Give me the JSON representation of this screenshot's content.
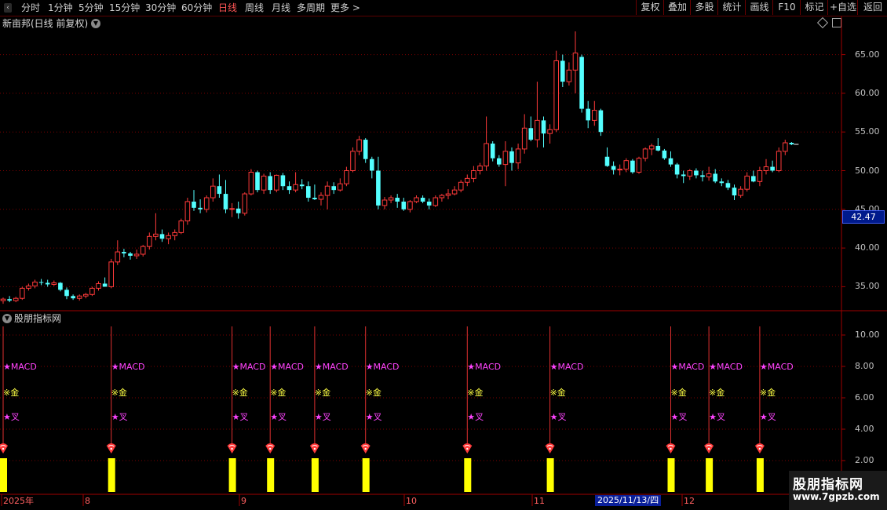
{
  "toolbar": {
    "periods": [
      {
        "label": "分时",
        "active": false
      },
      {
        "label": "1分钟",
        "active": false
      },
      {
        "label": "5分钟",
        "active": false
      },
      {
        "label": "15分钟",
        "active": false
      },
      {
        "label": "30分钟",
        "active": false
      },
      {
        "label": "60分钟",
        "active": false
      },
      {
        "label": "日线",
        "active": true
      },
      {
        "label": "周线",
        "active": false
      },
      {
        "label": "月线",
        "active": false
      },
      {
        "label": "多周期",
        "active": false
      },
      {
        "label": "更多 >",
        "active": false
      }
    ],
    "actions": [
      "复权",
      "叠加",
      "多股",
      "统计",
      "画线",
      "F10",
      "标记",
      "+自选",
      "返回"
    ]
  },
  "stock": {
    "title": "新亩邦(日线 前复权)"
  },
  "price_axis": {
    "labels": [
      "65.00",
      "60.00",
      "55.00",
      "50.00",
      "45.00",
      "40.00",
      "35.00"
    ],
    "current_price": "42.47"
  },
  "indicator": {
    "title": "股朋指标网",
    "axis_labels": [
      "10.00",
      "8.00",
      "6.00",
      "4.00",
      "2.00"
    ],
    "signal_texts": {
      "macd": "★MACD",
      "gold": "※金",
      "cross": "★叉"
    },
    "signals_count_note": ""
  },
  "dates": {
    "labels": [
      "2025年",
      "8",
      "9",
      "10",
      "11",
      "12"
    ],
    "cursor": "2025/11/13/四"
  },
  "watermark": {
    "line1": "股朋指标网",
    "line2": "www.7gpzb.com"
  },
  "colors": {
    "up": "#ff3a3a",
    "down": "#54ffff",
    "grid": "#7a0000",
    "signal_bar": "#ffff00",
    "signal_line": "#e03030"
  },
  "chart_data": {
    "type": "candlestick",
    "y_axis_labels": [
      "65.00",
      "60.00",
      "55.00",
      "50.00",
      "45.00",
      "40.00",
      "35.00"
    ],
    "ylim": [
      32,
      68
    ],
    "candles": [
      [
        33.2,
        33.6,
        32.8,
        33.4
      ],
      [
        33.4,
        33.8,
        33.0,
        33.2
      ],
      [
        33.2,
        33.7,
        33.0,
        33.5
      ],
      [
        33.5,
        35.0,
        33.3,
        34.8
      ],
      [
        34.8,
        35.4,
        34.5,
        35.1
      ],
      [
        35.1,
        35.9,
        34.8,
        35.6
      ],
      [
        35.6,
        36.0,
        35.2,
        35.5
      ],
      [
        35.5,
        35.9,
        35.0,
        35.3
      ],
      [
        35.3,
        35.8,
        35.1,
        35.5
      ],
      [
        35.5,
        35.6,
        34.4,
        34.6
      ],
      [
        34.6,
        34.9,
        33.4,
        33.8
      ],
      [
        33.8,
        34.0,
        33.3,
        33.5
      ],
      [
        33.5,
        34.0,
        33.2,
        33.8
      ],
      [
        33.8,
        34.2,
        33.5,
        34.0
      ],
      [
        34.0,
        35.0,
        33.8,
        34.8
      ],
      [
        34.8,
        35.7,
        34.5,
        35.4
      ],
      [
        35.4,
        36.2,
        35.0,
        35.0
      ],
      [
        35.0,
        38.6,
        34.8,
        38.2
      ],
      [
        38.2,
        41.0,
        37.8,
        39.5
      ],
      [
        39.5,
        39.9,
        38.8,
        39.3
      ],
      [
        39.3,
        39.5,
        38.5,
        39.0
      ],
      [
        39.0,
        39.8,
        38.6,
        39.2
      ],
      [
        39.2,
        40.4,
        38.9,
        40.2
      ],
      [
        40.2,
        42.0,
        39.8,
        41.5
      ],
      [
        41.5,
        44.5,
        41.0,
        41.8
      ],
      [
        41.8,
        42.4,
        40.8,
        41.2
      ],
      [
        41.2,
        42.0,
        40.5,
        41.6
      ],
      [
        41.6,
        42.4,
        41.0,
        42.0
      ],
      [
        42.0,
        43.8,
        41.8,
        43.5
      ],
      [
        43.5,
        46.5,
        43.0,
        46.0
      ],
      [
        46.0,
        47.5,
        44.8,
        45.2
      ],
      [
        45.2,
        46.3,
        44.5,
        45.0
      ],
      [
        45.0,
        46.8,
        44.6,
        46.5
      ],
      [
        46.5,
        49.0,
        46.0,
        48.0
      ],
      [
        48.0,
        49.5,
        46.5,
        47.0
      ],
      [
        47.0,
        48.8,
        44.5,
        45.0
      ],
      [
        45.0,
        45.8,
        44.0,
        45.1
      ],
      [
        45.1,
        46.0,
        43.8,
        44.5
      ],
      [
        44.5,
        47.2,
        44.2,
        47.0
      ],
      [
        47.0,
        50.2,
        46.8,
        49.8
      ],
      [
        49.8,
        50.0,
        47.2,
        47.5
      ],
      [
        47.5,
        49.6,
        47.0,
        49.3
      ],
      [
        49.3,
        49.8,
        47.0,
        47.5
      ],
      [
        47.5,
        49.5,
        47.2,
        49.4
      ],
      [
        49.4,
        49.7,
        47.5,
        48.0
      ],
      [
        48.0,
        48.6,
        47.0,
        47.5
      ],
      [
        47.5,
        49.8,
        47.2,
        48.2
      ],
      [
        48.2,
        48.9,
        47.6,
        48.0
      ],
      [
        48.0,
        48.6,
        46.0,
        46.5
      ],
      [
        46.5,
        48.2,
        46.2,
        46.3
      ],
      [
        46.3,
        47.2,
        45.5,
        46.8
      ],
      [
        46.8,
        48.6,
        45.0,
        48.0
      ],
      [
        48.0,
        48.5,
        47.0,
        47.5
      ],
      [
        47.5,
        49.0,
        47.3,
        48.3
      ],
      [
        48.3,
        50.5,
        48.0,
        50.0
      ],
      [
        50.0,
        53.0,
        49.8,
        52.5
      ],
      [
        52.5,
        54.5,
        52.0,
        54.0
      ],
      [
        54.0,
        54.2,
        51.0,
        51.5
      ],
      [
        51.5,
        51.8,
        49.0,
        50.0
      ],
      [
        50.0,
        51.8,
        45.0,
        45.5
      ],
      [
        45.5,
        46.6,
        45.0,
        46.2
      ],
      [
        46.2,
        46.8,
        45.8,
        46.5
      ],
      [
        46.5,
        47.0,
        45.2,
        46.0
      ],
      [
        46.0,
        46.5,
        44.8,
        45.0
      ],
      [
        45.0,
        46.2,
        44.6,
        46.0
      ],
      [
        46.0,
        46.8,
        45.8,
        46.5
      ],
      [
        46.5,
        46.8,
        45.8,
        46.0
      ],
      [
        46.0,
        46.4,
        45.0,
        45.5
      ],
      [
        45.5,
        46.8,
        45.3,
        46.5
      ],
      [
        46.5,
        47.0,
        46.0,
        46.8
      ],
      [
        46.8,
        47.6,
        46.3,
        47.0
      ],
      [
        47.0,
        48.0,
        46.8,
        47.5
      ],
      [
        47.5,
        48.8,
        47.2,
        48.5
      ],
      [
        48.5,
        49.5,
        48.0,
        49.0
      ],
      [
        49.0,
        50.6,
        48.5,
        50.0
      ],
      [
        50.0,
        51.0,
        49.5,
        50.6
      ],
      [
        50.6,
        57.0,
        50.0,
        53.5
      ],
      [
        53.5,
        53.8,
        51.2,
        51.6
      ],
      [
        51.6,
        52.0,
        50.5,
        50.8
      ],
      [
        50.8,
        53.8,
        48.0,
        52.5
      ],
      [
        52.5,
        53.0,
        50.0,
        51.0
      ],
      [
        51.0,
        53.5,
        50.2,
        52.8
      ],
      [
        52.8,
        57.3,
        52.2,
        55.5
      ],
      [
        55.5,
        57.0,
        53.8,
        54.0
      ],
      [
        54.0,
        61.5,
        53.0,
        56.5
      ],
      [
        56.5,
        57.0,
        53.0,
        54.8
      ],
      [
        54.8,
        56.0,
        53.5,
        55.3
      ],
      [
        55.3,
        65.5,
        55.0,
        64.2
      ],
      [
        64.2,
        65.0,
        60.8,
        61.5
      ],
      [
        61.5,
        64.0,
        61.0,
        63.0
      ],
      [
        63.0,
        68.0,
        60.0,
        65.2
      ],
      [
        64.7,
        65.0,
        57.5,
        58.0
      ],
      [
        58.0,
        59.0,
        55.5,
        56.5
      ],
      [
        56.5,
        59.0,
        55.8,
        57.8
      ],
      [
        57.8,
        58.0,
        54.5,
        55.0
      ],
      [
        51.8,
        53.0,
        50.5,
        50.6
      ],
      [
        50.6,
        51.2,
        49.5,
        50.1
      ],
      [
        50.1,
        50.8,
        49.4,
        50.2
      ],
      [
        50.2,
        51.6,
        49.8,
        51.3
      ],
      [
        51.3,
        51.5,
        49.6,
        49.8
      ],
      [
        49.8,
        51.8,
        49.6,
        51.6
      ],
      [
        51.6,
        53.0,
        51.2,
        52.8
      ],
      [
        52.8,
        53.5,
        52.0,
        53.2
      ],
      [
        53.2,
        54.2,
        52.5,
        52.6
      ],
      [
        52.6,
        52.8,
        51.4,
        51.6
      ],
      [
        51.6,
        52.5,
        50.5,
        50.8
      ],
      [
        50.8,
        51.0,
        49.0,
        49.5
      ],
      [
        49.5,
        50.0,
        48.4,
        49.3
      ],
      [
        49.3,
        50.2,
        48.8,
        50.0
      ],
      [
        50.0,
        50.3,
        49.0,
        49.4
      ],
      [
        49.4,
        50.0,
        48.6,
        49.2
      ],
      [
        49.2,
        50.5,
        48.7,
        49.6
      ],
      [
        49.6,
        50.2,
        48.4,
        48.6
      ],
      [
        48.6,
        49.0,
        48.0,
        48.4
      ],
      [
        48.4,
        48.8,
        47.5,
        47.8
      ],
      [
        47.8,
        48.2,
        46.2,
        46.8
      ],
      [
        46.8,
        48.0,
        46.5,
        47.6
      ],
      [
        47.6,
        49.8,
        47.3,
        49.3
      ],
      [
        49.3,
        50.0,
        48.5,
        48.6
      ],
      [
        48.6,
        50.5,
        48.0,
        50.0
      ],
      [
        50.0,
        51.5,
        49.5,
        50.5
      ],
      [
        50.5,
        51.3,
        49.8,
        50.0
      ],
      [
        50.0,
        53.0,
        49.8,
        52.5
      ],
      [
        52.5,
        54.0,
        52.0,
        53.6
      ],
      [
        53.6,
        53.7,
        53.3,
        53.4
      ]
    ],
    "indicator_ylim": [
      0,
      11
    ],
    "indicator_ticks": [
      "10.00",
      "8.00",
      "6.00",
      "4.00",
      "2.00"
    ],
    "signals": [
      0,
      17,
      36,
      42,
      49,
      57,
      73,
      86,
      105,
      111,
      119
    ]
  }
}
